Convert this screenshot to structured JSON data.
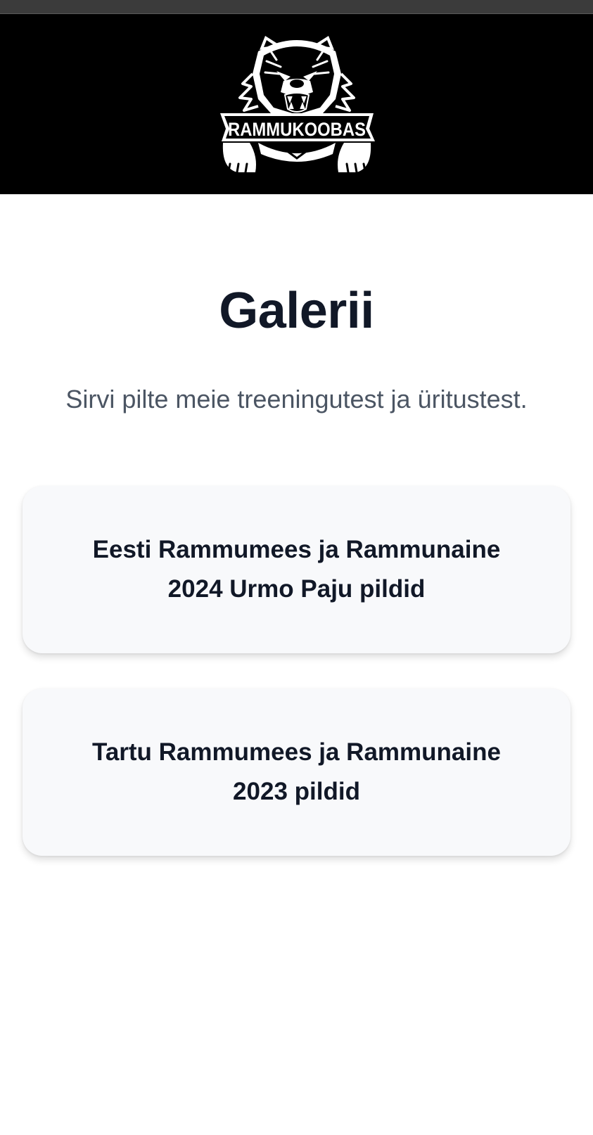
{
  "header": {
    "logo_text": "RAMMUKOOBAS",
    "logo_icon": "bear-mascot-logo"
  },
  "page": {
    "title": "Galerii",
    "subtitle": "Sirvi pilte meie treeningutest ja üritustest."
  },
  "galleries": [
    {
      "title": "Eesti Rammumees ja Rammunaine 2024 Urmo Paju pildid"
    },
    {
      "title": "Tartu Rammumees ja Rammunaine 2023 pildid"
    }
  ],
  "colors": {
    "header_bg": "#000000",
    "title": "#111827",
    "subtitle": "#4b5563",
    "card_bg": "#f8f9fb"
  }
}
